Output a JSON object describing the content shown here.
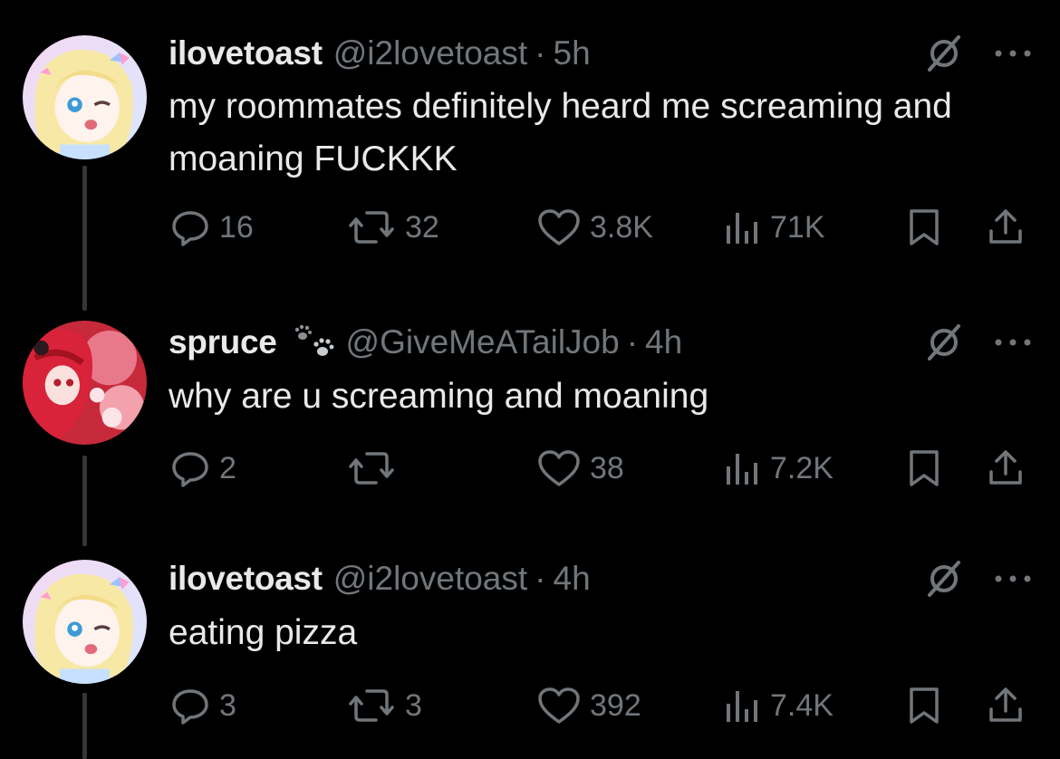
{
  "thread": [
    {
      "name": "ilovetoast",
      "handle": "@i2lovetoast",
      "separator": "·",
      "time": "5h",
      "text": "my roommates definitely heard me screaming and moaning FUCKKK",
      "replies": "16",
      "reposts": "32",
      "likes": "3.8K",
      "views": "71K",
      "avatar": "anime-girl-pastel-avatar"
    },
    {
      "name": "spruce",
      "handle": "@GiveMeATailJob",
      "separator": "·",
      "time": "4h",
      "text": "why are u screaming and moaning",
      "replies": "2",
      "reposts": "",
      "likes": "38",
      "views": "7.2K",
      "avatar": "anime-girl-red-avatar",
      "name_emoji": "paw-prints-icon"
    },
    {
      "name": "ilovetoast",
      "handle": "@i2lovetoast",
      "separator": "·",
      "time": "4h",
      "text": "eating pizza",
      "replies": "3",
      "reposts": "3",
      "likes": "392",
      "views": "7.4K",
      "avatar": "anime-girl-pastel-avatar"
    }
  ],
  "colors": {
    "background": "#000000",
    "text": "#e7e9ea",
    "muted": "#71767b",
    "thread_line": "#333639"
  }
}
